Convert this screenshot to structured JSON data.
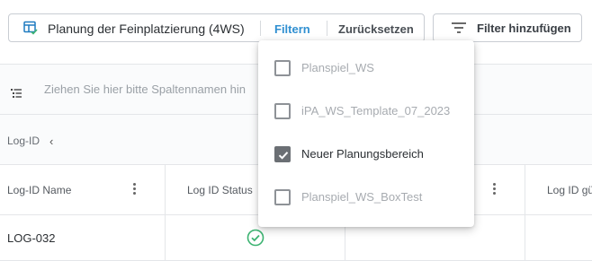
{
  "toolbar": {
    "view_title": "Planung der Feinplatzierung (4WS)",
    "filter_label": "Filtern",
    "reset_label": "Zurücksetzen",
    "add_filter_label": "Filter hinzufügen"
  },
  "columns_bar": {
    "placeholder": "Ziehen Sie hier bitte Spaltennamen hin"
  },
  "grouping": {
    "label": "Log-ID",
    "chevron": "‹"
  },
  "table": {
    "headers": [
      "Log-ID Name",
      "Log ID Status",
      "",
      "Log ID gü"
    ],
    "rows": [
      {
        "name": "LOG-032",
        "status": "ok"
      }
    ]
  },
  "dropdown": {
    "items": [
      {
        "label": "Planspiel_WS",
        "checked": false
      },
      {
        "label": "iPA_WS_Template_07_2023",
        "checked": false
      },
      {
        "label": "Neuer Planungsbereich",
        "checked": true
      },
      {
        "label": "Planspiel_WS_BoxTest",
        "checked": false
      }
    ]
  },
  "colors": {
    "accent": "#2f8fd1",
    "status_ok": "#3cb371",
    "view_icon": "#1f7bc0"
  }
}
